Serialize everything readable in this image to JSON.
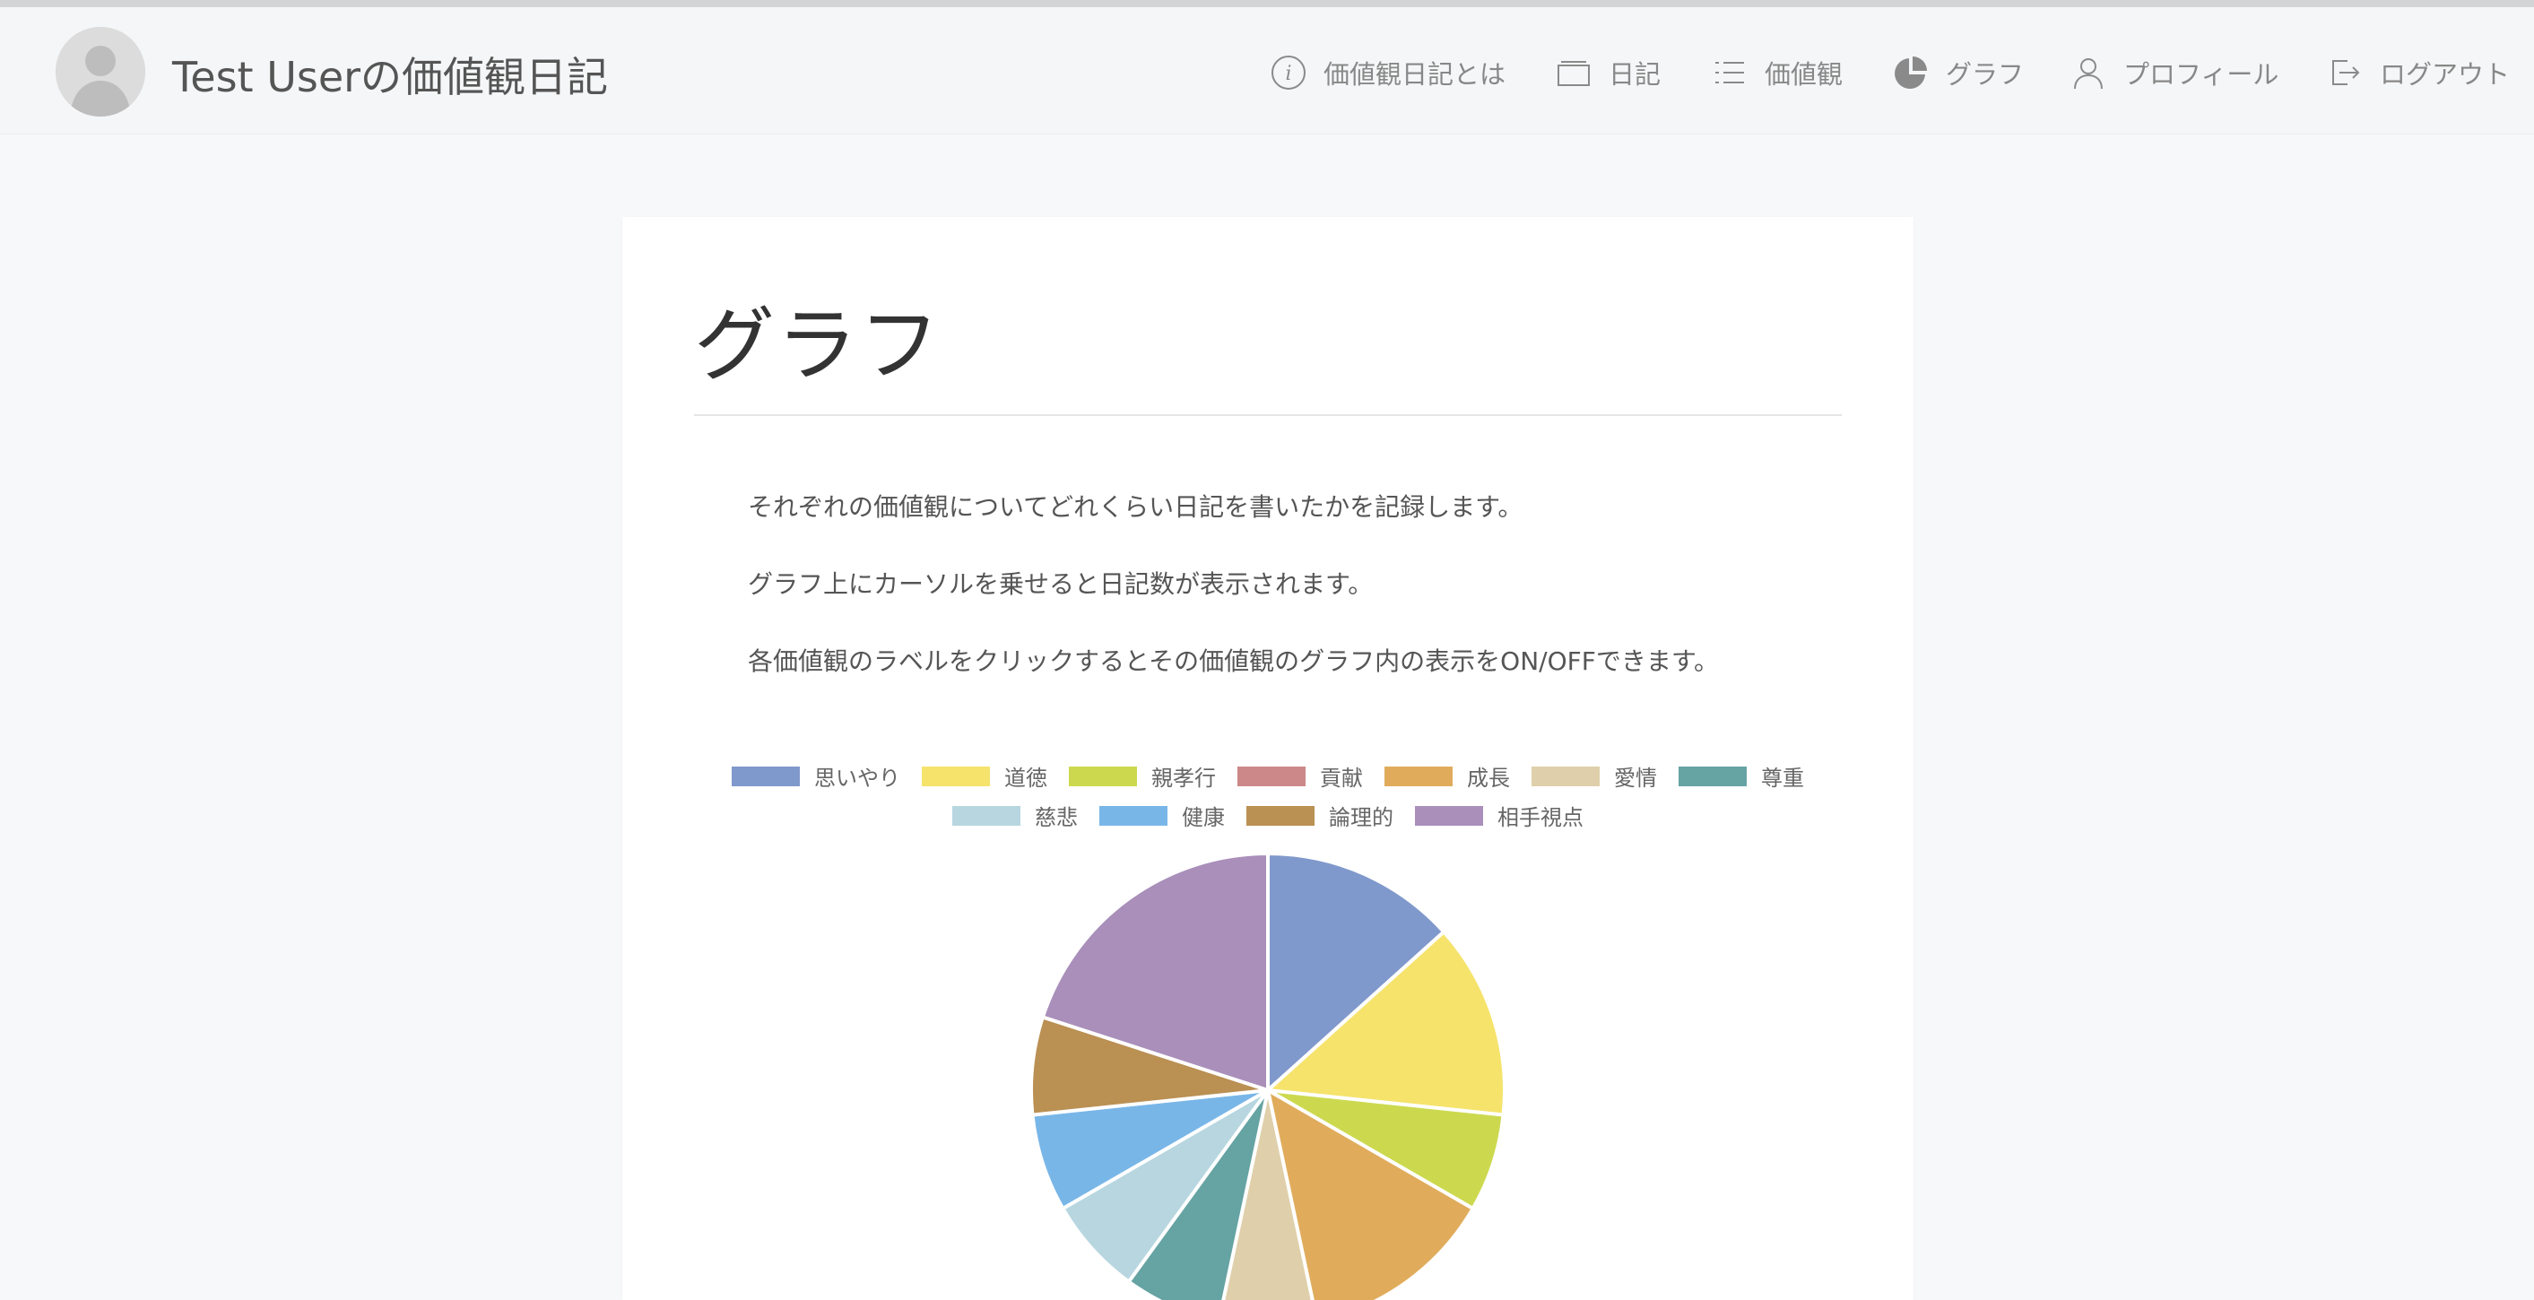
{
  "header": {
    "brand": "Test Userの価値観日記",
    "nav": [
      {
        "label": "価値観日記とは",
        "icon": "info-circle-icon"
      },
      {
        "label": "日記",
        "icon": "folder-icon"
      },
      {
        "label": "価値観",
        "icon": "list-icon"
      },
      {
        "label": "グラフ",
        "icon": "pie-chart-icon"
      },
      {
        "label": "プロフィール",
        "icon": "user-icon"
      },
      {
        "label": "ログアウト",
        "icon": "logout-icon"
      }
    ]
  },
  "main": {
    "title": "グラフ",
    "descriptions": [
      "それぞれの価値観についてどれくらい日記を書いたかを記録します。",
      "グラフ上にカーソルを乗せると日記数が表示されます。",
      "各価値観のラベルをクリックするとその価値観のグラフ内の表示をON/OFFできます。"
    ]
  },
  "chart_data": {
    "type": "pie",
    "categories": [
      "思いやり",
      "道徳",
      "親孝行",
      "貢献",
      "成長",
      "愛情",
      "尊重",
      "慈悲",
      "健康",
      "論理的",
      "相手視点"
    ],
    "values": [
      2,
      2,
      1,
      0,
      2,
      1,
      1,
      1,
      1,
      1,
      3
    ],
    "colors": [
      "#8099cc",
      "#f5e36c",
      "#ccd94f",
      "#cc8888",
      "#e0ac5c",
      "#dfd0ab",
      "#66a3a3",
      "#b7d6e0",
      "#79b6e8",
      "#ba9053",
      "#a98fba"
    ]
  }
}
